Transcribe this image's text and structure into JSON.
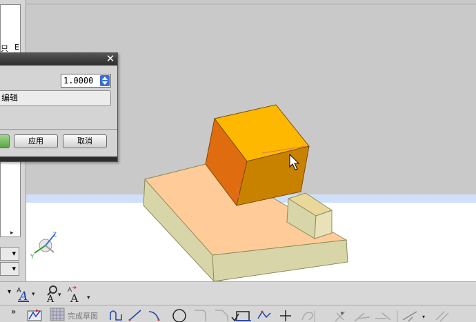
{
  "dialog": {
    "spinner_value": "1.0000",
    "field_text": "编辑",
    "apply_label": "应用",
    "cancel_label": "取消",
    "close_glyph": "✕"
  },
  "left_panel": {
    "tab_a": "只",
    "tab_b": "E",
    "scroll_glyph": "▸",
    "dropdown_glyph": "▾"
  },
  "triad": {
    "z_label": "Z",
    "y_label": "Y"
  },
  "toolbar1": {
    "overflow_glyph": "▾",
    "icons": [
      "text-style-icon",
      "find-text-icon",
      "text-edit-icon"
    ]
  },
  "toolbar2": {
    "overflow_glyph": "»",
    "finish_sketch_label": "完成草图",
    "icons": [
      "finish-sketch-icon",
      "profile-icon",
      "line-icon",
      "arc-icon",
      "circle-icon",
      "fillet-icon",
      "chamfer-icon",
      "rectangle-icon",
      "polygon-line-icon",
      "point-icon",
      "offset-curve-icon",
      "trim-icon",
      "extend-icon",
      "make-corner-icon",
      "dimension-icon",
      "constraint-icon"
    ]
  },
  "colors": {
    "viewport_bg": "#c9c9c9",
    "floor": "#ffffff",
    "horizon_band": "#cfe0f8",
    "base_top": "#ffcc99",
    "base_side": "#d8d5a8",
    "cube_top": "#ffb800",
    "cube_left": "#e06c10",
    "cube_front": "#c98200",
    "accent_blue": "#3a6fd8"
  }
}
